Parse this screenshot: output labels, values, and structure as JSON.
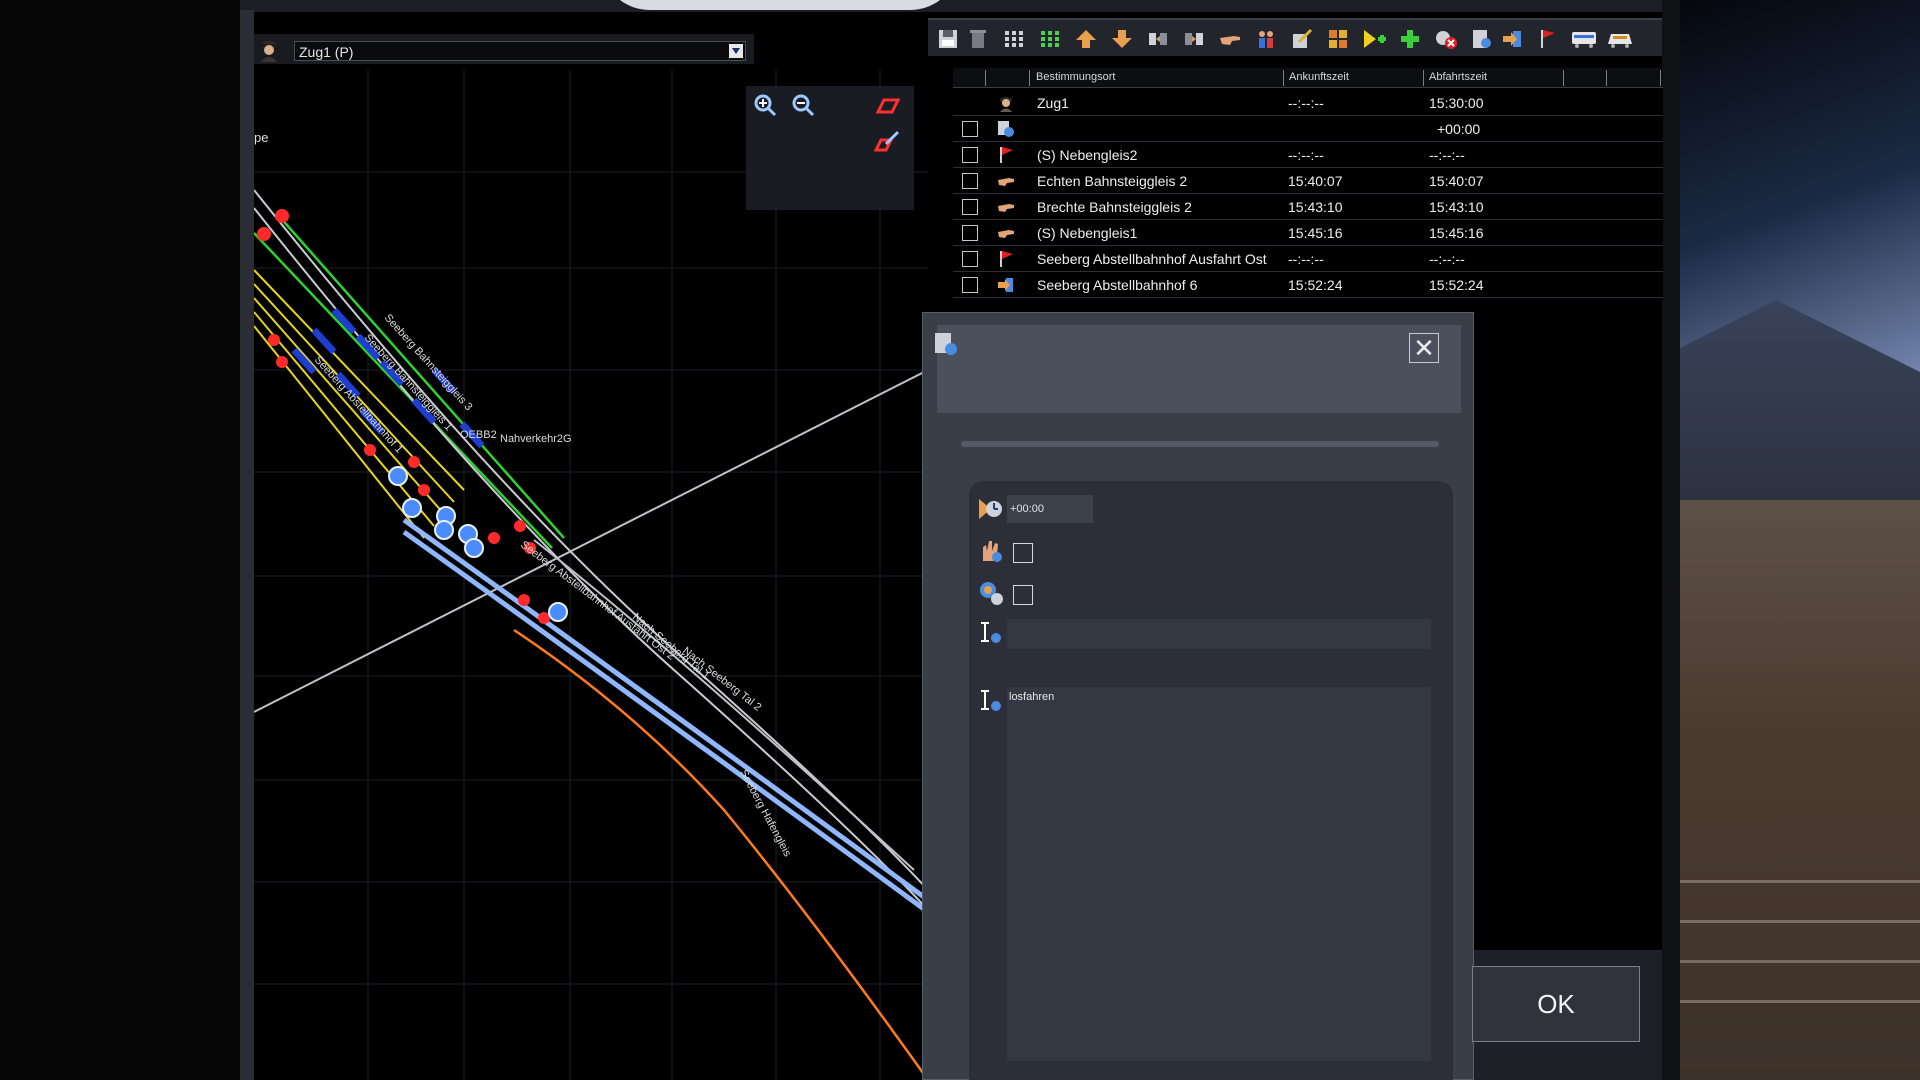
{
  "train_selector": {
    "selected_train": "Zug1 (P)",
    "icon": "driver-icon"
  },
  "map": {
    "edge_label": "pe",
    "track_labels": [
      "Seeberg Bahnsteiggleis 3",
      "Seeberg Bahnsteiggleis 1",
      "Seeberg Abstellbahnhof 1",
      "OEBB2",
      "Nahverkehr2G",
      "Seeberg Abstellbahnhof Ausfahrt Ost 2",
      "Nach Seeberg Tal 1",
      "Nach Seeberg Tal 2",
      "Seeberg Hafengleis"
    ],
    "zoom_in_icon": "zoom-in-icon",
    "zoom_out_icon": "zoom-out-icon"
  },
  "toolbar": {
    "buttons": [
      "save-icon",
      "delete-icon",
      "grid-icon",
      "grid-green-icon",
      "move-up-icon",
      "move-down-icon",
      "split-icon",
      "merge-icon",
      "pointing-hand-icon",
      "people-icon",
      "edit-schedule-icon",
      "formation-icon",
      "add-yellow-icon",
      "add-green-icon",
      "remove-stop-icon",
      "instruction-icon",
      "arrive-icon",
      "flag-icon",
      "wagon-icon",
      "locomotive-icon"
    ]
  },
  "schedule": {
    "headers": {
      "destination": "Bestimmungsort",
      "arrival": "Ankunftszeit",
      "departure": "Abfahrtszeit"
    },
    "rows": [
      {
        "icon": "driver-icon",
        "destination": "Zug1",
        "arrival": "--:--:--",
        "departure": "15:30:00",
        "has_checkbox": false
      },
      {
        "icon": "instruction-icon",
        "destination": "",
        "arrival": "",
        "departure": "+00:00",
        "has_checkbox": true
      },
      {
        "icon": "flag-icon",
        "destination": "(S) Nebengleis2",
        "arrival": "--:--:--",
        "departure": "--:--:--",
        "has_checkbox": true
      },
      {
        "icon": "pointing-hand-icon",
        "destination": "Echten Bahnsteiggleis 2",
        "arrival": "15:40:07",
        "departure": "15:40:07",
        "has_checkbox": true
      },
      {
        "icon": "pointing-hand-icon",
        "destination": "Brechte Bahnsteiggleis 2",
        "arrival": "15:43:10",
        "departure": "15:43:10",
        "has_checkbox": true
      },
      {
        "icon": "pointing-hand-icon",
        "destination": "(S) Nebengleis1",
        "arrival": "15:45:16",
        "departure": "15:45:16",
        "has_checkbox": true
      },
      {
        "icon": "flag-icon",
        "destination": "Seeberg Abstellbahnhof Ausfahrt Ost",
        "arrival": "--:--:--",
        "departure": "--:--:--",
        "has_checkbox": true
      },
      {
        "icon": "arrive-icon",
        "destination": "Seeberg Abstellbahnhof 6",
        "arrival": "15:52:24",
        "departure": "15:52:24",
        "has_checkbox": true
      }
    ]
  },
  "dialog": {
    "offset_value": "+00:00",
    "script_text": "losfahren",
    "ok_label": "OK",
    "close_glyph": "✕"
  },
  "colors": {
    "background": "#000000",
    "panel": "#3a3e49",
    "track_green": "#2ed12e",
    "track_yellow": "#e6d51a",
    "track_blue": "#1d3ecf",
    "track_orange": "#ff7a1a",
    "signal_red": "#ff2a2a",
    "node_blue": "#4a8cff"
  }
}
